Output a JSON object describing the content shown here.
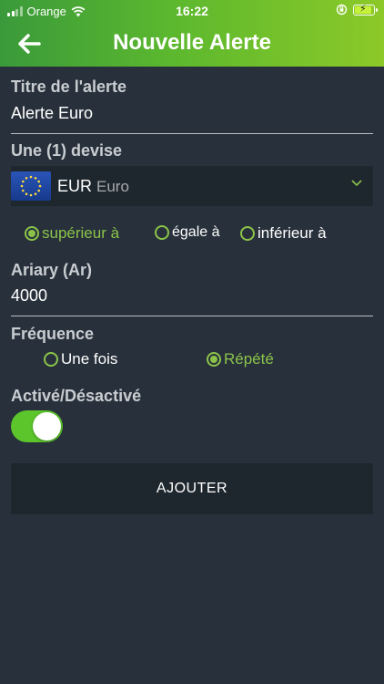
{
  "status_bar": {
    "carrier": "Orange",
    "time": "16:22"
  },
  "header": {
    "title": "Nouvelle Alerte"
  },
  "alert_title": {
    "label": "Titre de l'alerte",
    "value": "Alerte Euro"
  },
  "currency": {
    "label": "Une (1) devise",
    "code": "EUR",
    "name": "Euro"
  },
  "comparison": {
    "options": [
      "supérieur à",
      "égale à",
      "inférieur à"
    ],
    "selected": "supérieur à"
  },
  "amount": {
    "label": "Ariary (Ar)",
    "value": "4000"
  },
  "frequency": {
    "label": "Fréquence",
    "options": [
      "Une fois",
      "Répété"
    ],
    "selected": "Répété"
  },
  "active": {
    "label": "Activé/Désactivé",
    "enabled": true
  },
  "submit": {
    "label": "AJOUTER"
  },
  "colors": {
    "accent": "#8bc34a",
    "background": "#28313b",
    "toggle_on": "#5cc52c"
  }
}
